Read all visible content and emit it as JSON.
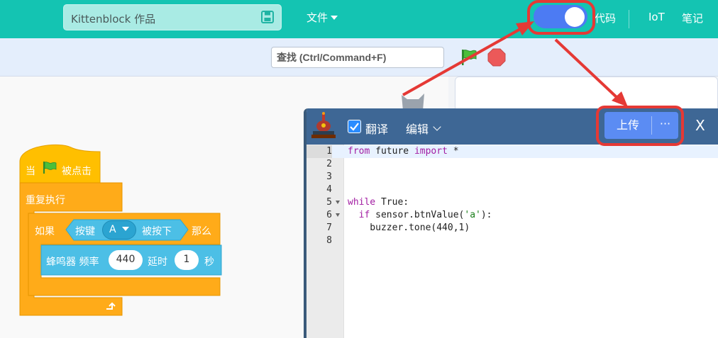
{
  "topbar": {
    "project_title": "Kittenblock 作品",
    "file_menu": "文件",
    "code_label": "代码",
    "iot_label": "IoT",
    "notes_label": "笔记"
  },
  "toolbar": {
    "search_placeholder": "查找 (Ctrl/Command+F)"
  },
  "blocks": {
    "when_label": "当",
    "clicked_label": "被点击",
    "forever_label": "重复执行",
    "if_label": "如果",
    "key_label": "按键",
    "key_value": "A",
    "pressed_label": "被按下",
    "then_label": "那么",
    "buzzer_label": "蜂鸣器 频率",
    "freq_value": "440",
    "delay_label": "延时",
    "delay_value": "1",
    "sec_label": "秒"
  },
  "code_panel": {
    "translate_label": "翻译",
    "translate_checked": true,
    "edit_menu": "编辑",
    "upload_label": "上传",
    "more_label": "···",
    "close_label": "X",
    "lines": [
      {
        "n": "1",
        "text": "from future import *"
      },
      {
        "n": "2",
        "text": ""
      },
      {
        "n": "3",
        "text": ""
      },
      {
        "n": "4",
        "text": ""
      },
      {
        "n": "5",
        "text": "while True:"
      },
      {
        "n": "6",
        "text": "  if sensor.btnValue('a'):"
      },
      {
        "n": "7",
        "text": "    buzzer.tone(440,1)"
      },
      {
        "n": "8",
        "text": ""
      }
    ]
  },
  "colors": {
    "topbar": "#14c4b2",
    "toggle": "#4c7bf3",
    "annotation": "#e53935",
    "block_control": "#ffab19",
    "block_sensor": "#4cbfe6",
    "code_header": "#3e6795"
  }
}
